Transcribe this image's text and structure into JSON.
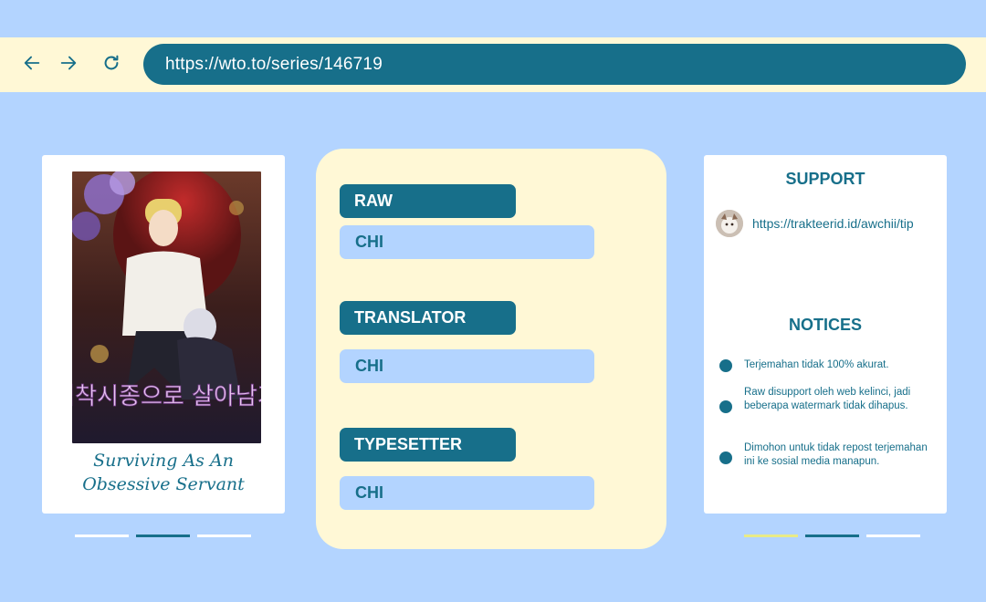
{
  "browser": {
    "url": "https://wto.to/series/146719",
    "icons": {
      "back": "arrow-left-icon",
      "forward": "arrow-right-icon",
      "reload": "reload-icon"
    }
  },
  "series": {
    "title_line1": "Surviving As An",
    "title_line2": "Obsessive Servant",
    "cover_text": "집착시종으로 살아남기"
  },
  "credits": [
    {
      "role": "RAW",
      "value": "CHI"
    },
    {
      "role": "TRANSLATOR",
      "value": "CHI"
    },
    {
      "role": "TYPESETTER",
      "value": "CHI"
    }
  ],
  "support": {
    "title": "SUPPORT",
    "link": "https://trakteerid.id/awchii/tip"
  },
  "notices": {
    "title": "NOTICES",
    "items": [
      "Terjemahan tidak 100% akurat.",
      "Raw disupport oleh web kelinci, jadi beberapa watermark tidak dihapus.",
      "Dimohon untuk tidak repost terjemahan ini ke sosial media manapun."
    ]
  },
  "colors": {
    "background": "#b3d4ff",
    "accent": "#176f8a",
    "cream": "#fff8d6",
    "highlight": "#e9eb86"
  }
}
